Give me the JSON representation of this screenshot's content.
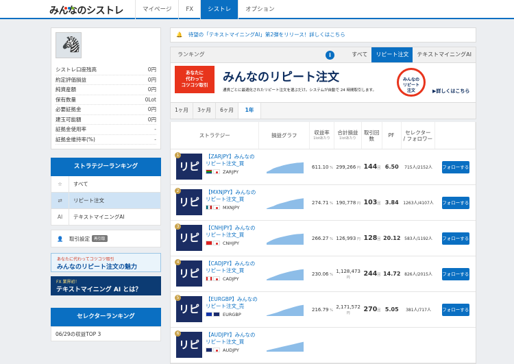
{
  "header": {
    "logo": "みんなのシストレ",
    "nav": [
      "マイページ",
      "FX",
      "シストレ",
      "オプション"
    ],
    "active_nav": 2
  },
  "profile": {
    "rows": [
      {
        "label": "シストレ口座残高",
        "value": "0円"
      },
      {
        "label": "約定評価損益",
        "value": "0円"
      },
      {
        "label": "純資産額",
        "value": "0円"
      },
      {
        "label": "保有数量",
        "value": "0Lot"
      },
      {
        "label": "必要証拠金",
        "value": "0円"
      },
      {
        "label": "建玉可能額",
        "value": "0円"
      },
      {
        "label": "証拠金使用率",
        "value": "-"
      },
      {
        "label": "証拠金維持率(%)",
        "value": "-"
      }
    ]
  },
  "strategy_ranking": {
    "title": "ストラテジーランキング",
    "items": [
      {
        "icon": "☆",
        "label": "すべて"
      },
      {
        "icon": "⇄",
        "label": "リピート注文"
      },
      {
        "icon": "AI",
        "label": "テキストマイニングAI"
      }
    ],
    "settings_label": "取引設定",
    "settings_badge": "再引取"
  },
  "banners": {
    "repeat_small": "あなたに代わってコツコツ取引",
    "repeat_big": "みんなのリピート注文の魅力",
    "ai_small": "FX 業界初！",
    "ai_big": "テキストマイニング AI とは？"
  },
  "selector_ranking": {
    "title": "セレクターランキング",
    "sub": "06/29の収益TOP 3"
  },
  "notice": "待望の「テキストマイニングAI」第2弾をリリース！詳しくはこちら",
  "ranking": {
    "label": "ランキング",
    "tabs": [
      "すべて",
      "リピート注文",
      "テキストマイニングAI"
    ],
    "active_tab": 1
  },
  "hero": {
    "box": "あなたに\n代わって\nコツコツ取引",
    "title": "みんなのリピート注文",
    "sub": "通貨ごとに最適化されたリピート注文を選ぶだけ。システムが自動で 24 時間取引します。",
    "badge": "みんなの\nリピート\n注文",
    "more": "▶詳しくはこちら"
  },
  "periods": [
    "1ヶ月",
    "3ヶ月",
    "6ヶ月",
    "1年"
  ],
  "active_period": 3,
  "table": {
    "headers": {
      "strategy": "ストラテジー",
      "graph": "損益グラフ",
      "roi": "収益率",
      "roi_sub": "1lotあたり",
      "pl": "合計損益",
      "pl_sub": "1lotあたり",
      "count": "取引回数",
      "pf": "PF",
      "selector": "セレクター\n/ フォロワー"
    },
    "follow_label": "フォローする",
    "rows": [
      {
        "rank": "1",
        "name": "【ZARJPY】みんなのリピート注文_買",
        "pair": "ZARJPY",
        "roi": "611.10",
        "pl": "299,266",
        "count": "144",
        "pf": "6.50",
        "sel": "715人/2152人",
        "flags": [
          "za",
          "jp"
        ],
        "curve": [
          0.12,
          0.25,
          0.4,
          0.5,
          0.58,
          0.66,
          0.72,
          0.78,
          0.82,
          0.86,
          0.88,
          0.9
        ]
      },
      {
        "rank": "2",
        "name": "【MXNJPY】みんなのリピート注文_買",
        "pair": "MXNJPY",
        "roi": "274.71",
        "pl": "190,778",
        "count": "103",
        "pf": "3.84",
        "sel": "1263人/4107人",
        "flags": [
          "mx",
          "jp"
        ],
        "curve": [
          0.05,
          0.15,
          0.24,
          0.36,
          0.45,
          0.52,
          0.6,
          0.68,
          0.74,
          0.8,
          0.84,
          0.88
        ]
      },
      {
        "rank": "3",
        "name": "【CNHJPY】みんなのリピート注文_買",
        "pair": "CNHJPY",
        "roi": "266.27",
        "pl": "126,993",
        "count": "128",
        "pf": "20.12",
        "sel": "583人/1192人",
        "flags": [
          "cn",
          "jp"
        ],
        "curve": [
          0.15,
          0.3,
          0.42,
          0.52,
          0.6,
          0.66,
          0.72,
          0.78,
          0.83,
          0.86,
          0.88,
          0.9
        ]
      },
      {
        "rank": "4",
        "name": "【CADJPY】みんなのリピート注文_買",
        "pair": "CADJPY",
        "roi": "230.06",
        "pl": "1,128,473",
        "count": "244",
        "pf": "14.72",
        "sel": "826人/2015人",
        "flags": [
          "ca",
          "jp"
        ],
        "curve": [
          0.08,
          0.2,
          0.3,
          0.4,
          0.5,
          0.58,
          0.65,
          0.72,
          0.78,
          0.83,
          0.87,
          0.9
        ]
      },
      {
        "rank": "5",
        "name": "【EURGBP】みんなのリピート注文_売",
        "pair": "EURGBP",
        "roi": "216.79",
        "pl": "2,171,572",
        "count": "270",
        "pf": "5.05",
        "sel": "381人/717人",
        "flags": [
          "eu",
          "gb"
        ],
        "curve": [
          0.05,
          0.12,
          0.2,
          0.28,
          0.38,
          0.48,
          0.56,
          0.64,
          0.72,
          0.8,
          0.86,
          0.9
        ]
      },
      {
        "rank": "6",
        "name": "【AUDJPY】みんなのリピート注文_買",
        "pair": "AUDJPY",
        "roi": "",
        "pl": "",
        "count": "",
        "pf": "",
        "sel": "",
        "flags": [
          "au",
          "jp"
        ],
        "curve": [
          0.1,
          0.2,
          0.3,
          0.4,
          0.5,
          0.6,
          0.7,
          0.8
        ]
      }
    ]
  },
  "colors": {
    "primary": "#0a6fc2",
    "hero_red": "#e8341c",
    "icon_navy": "#1b2d63"
  }
}
